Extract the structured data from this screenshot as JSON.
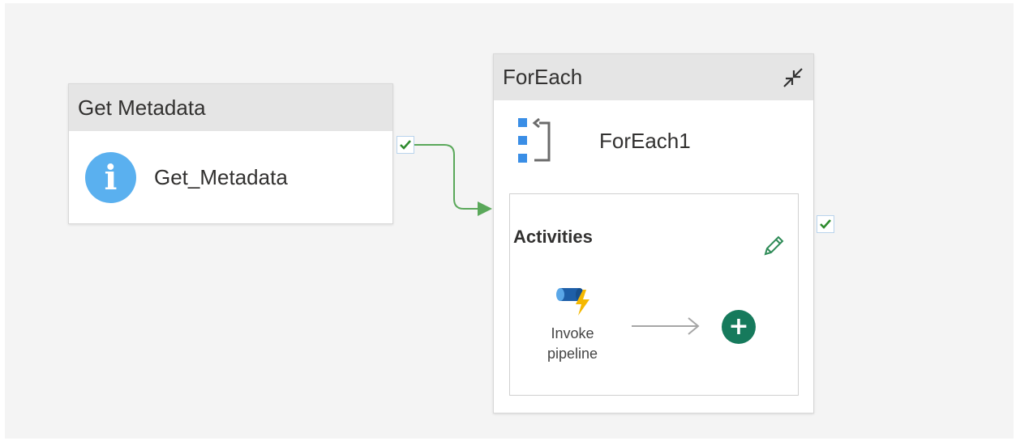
{
  "get_metadata": {
    "header": "Get Metadata",
    "name": "Get_Metadata",
    "icon": "info-icon",
    "icon_glyph": "i",
    "status": "success-check-icon"
  },
  "foreach": {
    "header": "ForEach",
    "name": "ForEach1",
    "icon": "foreach-icon",
    "collapse_icon": "collapse-icon",
    "status": "success-check-icon",
    "activities": {
      "label": "Activities",
      "edit_icon": "pencil-icon",
      "inner_activity": {
        "label_line1": "Invoke",
        "label_line2": "pipeline",
        "icon": "invoke-pipeline-icon"
      },
      "add_button": "+"
    }
  },
  "colors": {
    "canvas": "#f4f4f4",
    "header": "#e5e5e5",
    "connector_success": "#5aa85a",
    "info_blue": "#5ab0ef",
    "add_green": "#167a5c"
  }
}
